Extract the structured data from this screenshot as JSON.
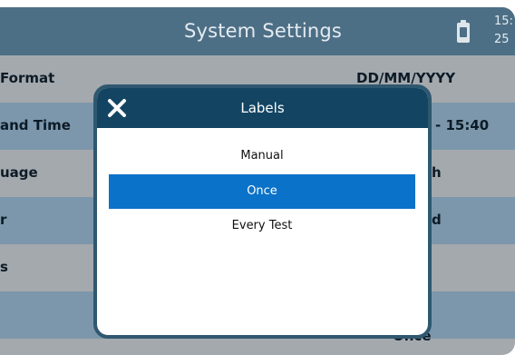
{
  "header": {
    "title": "System Settings",
    "battery_icon": "battery-charging-icon",
    "clock_lines": [
      "15:",
      "25"
    ]
  },
  "settings": {
    "rows": [
      {
        "label": "Format",
        "value": "DD/MM/YYYY",
        "shade": "light"
      },
      {
        "label": "and Time",
        "value": "- 15:40",
        "shade": "dark"
      },
      {
        "label": "uage",
        "value": "h",
        "shade": "light"
      },
      {
        "label": "r",
        "value": "d",
        "shade": "dark"
      },
      {
        "label": "s",
        "value": "",
        "shade": "light"
      },
      {
        "label": "",
        "value": "Once",
        "shade": "dark"
      }
    ]
  },
  "dialog": {
    "title": "Labels",
    "close_icon": "close-icon",
    "options": [
      "Manual",
      "Once",
      "Every Test"
    ],
    "selected": "Once"
  },
  "colors": {
    "header": "#4d6f86",
    "row_dark": "#7c97ab",
    "row_light": "#a4a9ad",
    "dialog_header": "#134563",
    "selected": "#0a72c8"
  }
}
